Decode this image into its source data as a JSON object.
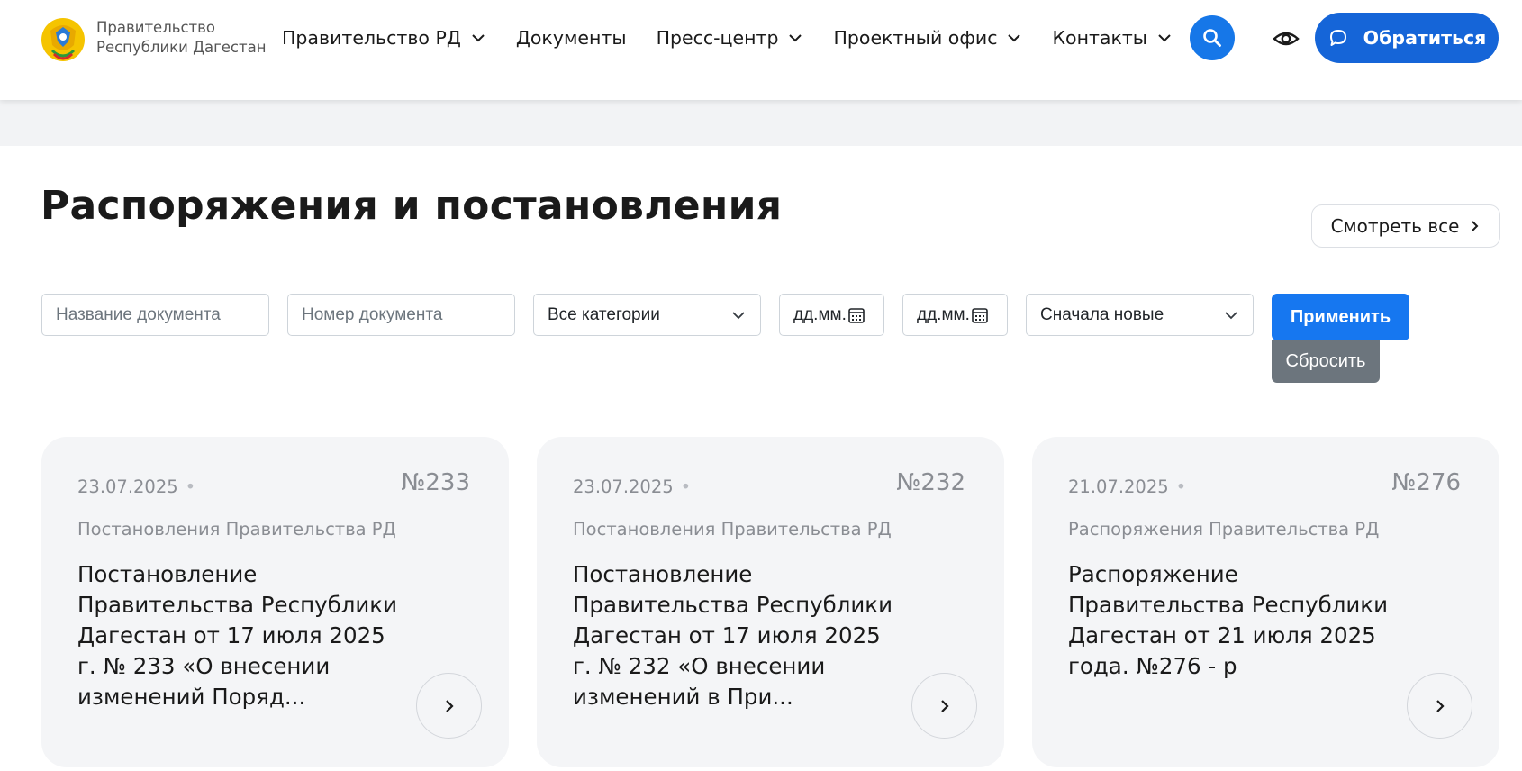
{
  "header": {
    "logo_line1": "Правительство",
    "logo_line2": "Республики Дагестан",
    "nav": [
      {
        "label": "Правительство РД",
        "has_dropdown": true
      },
      {
        "label": "Документы",
        "has_dropdown": false
      },
      {
        "label": "Пресс-центр",
        "has_dropdown": true
      },
      {
        "label": "Проектный офис",
        "has_dropdown": true
      },
      {
        "label": "Контакты",
        "has_dropdown": true
      }
    ],
    "search_icon": "search-icon",
    "eye_icon": "eye-icon",
    "appeal_label": "Обратиться",
    "appeal_icon": "chat-bubble-icon"
  },
  "colors": {
    "accent": "#1677e8",
    "appeal": "#1565d8",
    "apply": "#1677f0",
    "reset": "#6c757d",
    "card_bg": "#f4f5f7"
  },
  "main": {
    "title": "Распоряжения и постановления",
    "view_all_label": "Смотреть все"
  },
  "filters": {
    "name_placeholder": "Название документа",
    "number_placeholder": "Номер документа",
    "category_value": "Все категории",
    "date_from": "дд.мм.",
    "date_to": "дд.мм.",
    "sort_value": "Сначала новые",
    "apply_label": "Применить",
    "reset_label": "Сбросить"
  },
  "cards": [
    {
      "date": "23.07.2025",
      "number": "№233",
      "category": "Постановления Правительства РД",
      "title": "Постановление Правительства Республики Дагестан от 17 июля 2025 г. № 233 «О внесении изменений Поряд..."
    },
    {
      "date": "23.07.2025",
      "number": "№232",
      "category": "Постановления Правительства РД",
      "title": "Постановление Правительства Республики Дагестан от 17 июля 2025 г. № 232 «О внесении изменений в При..."
    },
    {
      "date": "21.07.2025",
      "number": "№276",
      "category": "Распоряжения Правительства РД",
      "title": "Распоряжение Правительства Республики Дагестан от 21 июля 2025 года. №276 - р"
    }
  ]
}
